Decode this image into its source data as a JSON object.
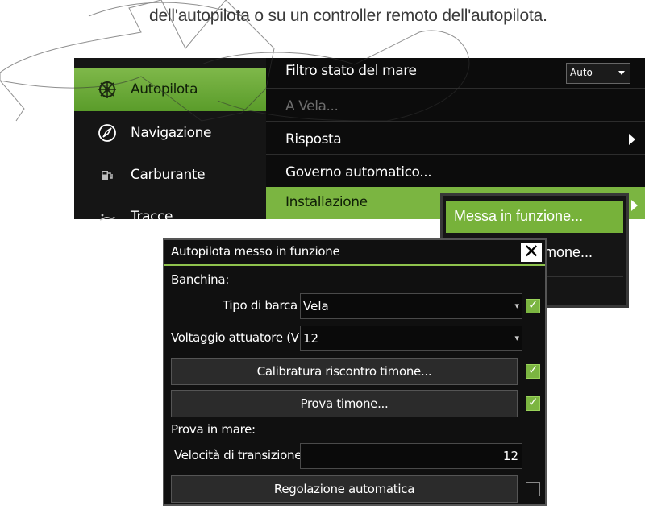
{
  "intro_text": "dell'autopilota o su un controller remoto dell'autopilota.",
  "left_menu": {
    "items": [
      {
        "label": "Autopilota",
        "icon": "helm-wheel-icon",
        "active": true
      },
      {
        "label": "Navigazione",
        "icon": "compass-icon",
        "active": false
      },
      {
        "label": "Carburante",
        "icon": "fuel-pump-icon",
        "active": false
      },
      {
        "label": "Tracce",
        "icon": "track-icon",
        "active": false
      }
    ]
  },
  "right_menu": {
    "items": [
      {
        "label": "Filtro stato del mare",
        "select_value": "Auto"
      },
      {
        "label": "A Vela...",
        "disabled": true
      },
      {
        "label": "Risposta",
        "has_submenu": true
      },
      {
        "label": "Governo automatico..."
      },
      {
        "label": "Installazione",
        "has_submenu": true,
        "highlighted": true
      }
    ]
  },
  "submenu": {
    "items": [
      {
        "label": "Messa in funzione...",
        "highlighted": true
      },
      {
        "label": "mone..."
      }
    ]
  },
  "dialog": {
    "title": "Autopilota messo in funzione",
    "section_dock": "Banchina:",
    "boat_type_label": "Tipo di barca",
    "boat_type_value": "Vela",
    "actuator_voltage_label": "Voltaggio attuatore (V)",
    "actuator_voltage_value": "12",
    "rudder_feedback_button": "Calibratura riscontro timone...",
    "rudder_test_button": "Prova timone...",
    "section_sea": "Prova in mare:",
    "transition_speed_label": "Velocità di transizione",
    "transition_speed_value": "12",
    "autotune_button": "Regolazione automatica",
    "checks": {
      "boat_type": true,
      "rudder_feedback": true,
      "rudder_test": true,
      "autotune": false
    }
  },
  "colors": {
    "accent_green": "#7bb541",
    "background": "#0c0c0c"
  }
}
